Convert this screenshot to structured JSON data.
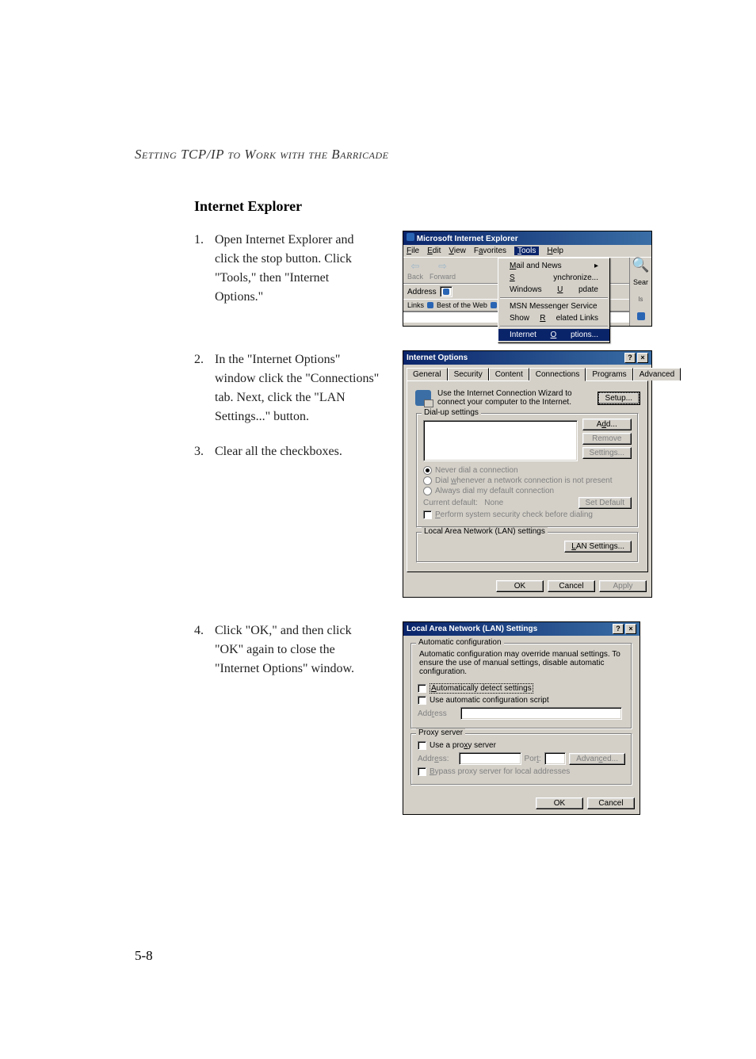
{
  "header": "Setting TCP/IP to Work with the Barricade",
  "section_title": "Internet Explorer",
  "page_number": "5-8",
  "steps": [
    {
      "num": "1.",
      "text": "Open Internet Explorer and click the stop button. Click \"Tools,\" then \"Internet Options.\""
    },
    {
      "num": "2.",
      "text": "In the \"Internet Options\" window click the \"Connections\" tab. Next, click the \"LAN Settings...\" button."
    },
    {
      "num": "3.",
      "text": "Clear all the checkboxes."
    },
    {
      "num": "4.",
      "text": "Click \"OK,\" and then click \"OK\" again to close the \"Internet Options\" window."
    }
  ],
  "ie_window": {
    "title": "Microsoft Internet Explorer",
    "menus": {
      "file": "File",
      "edit": "Edit",
      "view": "View",
      "favorites": "Favorites",
      "tools": "Tools",
      "help": "Help"
    },
    "nav": {
      "back": "Back",
      "forward": "Forward"
    },
    "address_label": "Address",
    "links_label": "Links",
    "links_item": "Best of the Web",
    "search_label": "Sear",
    "tools_menu": {
      "mail": "Mail and News",
      "sync": "Synchronize...",
      "wu": "Windows Update",
      "msn": "MSN Messenger Service",
      "related": "Show Related Links",
      "io": "Internet Options..."
    }
  },
  "io_dialog": {
    "title": "Internet Options",
    "tabs": {
      "general": "General",
      "security": "Security",
      "content": "Content",
      "connections": "Connections",
      "programs": "Programs",
      "advanced": "Advanced"
    },
    "wizard_text": "Use the Internet Connection Wizard to connect your computer to the Internet.",
    "setup": "Setup...",
    "dialup_legend": "Dial-up settings",
    "add": "Add...",
    "remove": "Remove",
    "settings": "Settings...",
    "never": "Never dial a connection",
    "dialwhenever": "Dial whenever a network connection is not present",
    "always": "Always dial my default connection",
    "current_label": "Current default:",
    "current_value": "None",
    "set_default": "Set Default",
    "perform": "Perform system security check before dialing",
    "lan_legend": "Local Area Network (LAN) settings",
    "lan_settings": "LAN Settings...",
    "ok": "OK",
    "cancel": "Cancel",
    "apply": "Apply"
  },
  "lan_dialog": {
    "title": "Local Area Network (LAN) Settings",
    "auto_legend": "Automatic configuration",
    "auto_desc": "Automatic configuration may override manual settings. To ensure the use of manual settings, disable automatic configuration.",
    "auto_detect": "Automatically detect settings",
    "use_script": "Use automatic configuration script",
    "address_label": "Address",
    "proxy_legend": "Proxy server",
    "use_proxy": "Use a proxy server",
    "proxy_addr": "Address:",
    "proxy_port": "Port:",
    "advanced": "Advanced...",
    "bypass": "Bypass proxy server for local addresses",
    "ok": "OK",
    "cancel": "Cancel"
  }
}
